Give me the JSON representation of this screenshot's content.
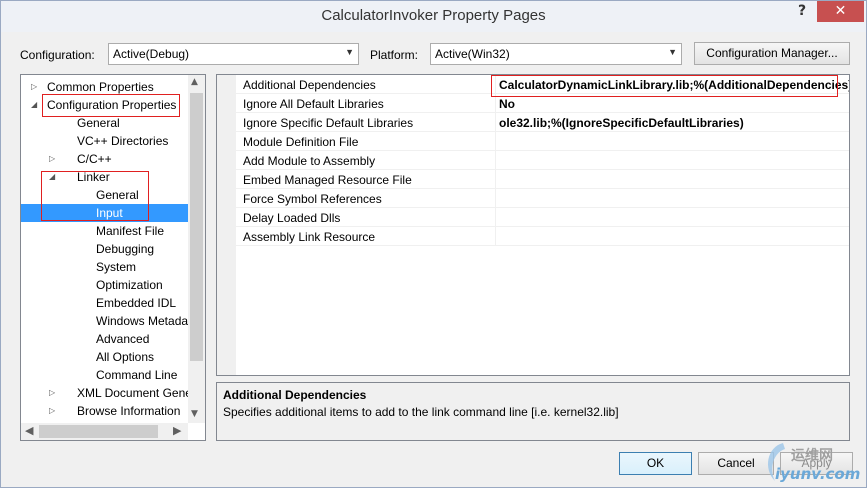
{
  "window": {
    "title": "CalculatorInvoker Property Pages",
    "help_label": "?",
    "close_label": "✕"
  },
  "config": {
    "configuration_label": "Configuration:",
    "configuration_value": "Active(Debug)",
    "platform_label": "Platform:",
    "platform_value": "Active(Win32)",
    "manager_button": "Configuration Manager..."
  },
  "tree": {
    "items": [
      {
        "label": "Common Properties",
        "expander": "▷"
      },
      {
        "label": "Configuration Properties",
        "expander": "◢"
      },
      {
        "label": "General",
        "expander": ""
      },
      {
        "label": "VC++ Directories",
        "expander": ""
      },
      {
        "label": "C/C++",
        "expander": "▷"
      },
      {
        "label": "Linker",
        "expander": "◢"
      },
      {
        "label": "General",
        "expander": ""
      },
      {
        "label": "Input",
        "expander": ""
      },
      {
        "label": "Manifest File",
        "expander": ""
      },
      {
        "label": "Debugging",
        "expander": ""
      },
      {
        "label": "System",
        "expander": ""
      },
      {
        "label": "Optimization",
        "expander": ""
      },
      {
        "label": "Embedded IDL",
        "expander": ""
      },
      {
        "label": "Windows Metadata",
        "expander": ""
      },
      {
        "label": "Advanced",
        "expander": ""
      },
      {
        "label": "All Options",
        "expander": ""
      },
      {
        "label": "Command Line",
        "expander": ""
      },
      {
        "label": "XML Document Genera",
        "expander": "▷"
      },
      {
        "label": "Browse Information",
        "expander": "▷"
      }
    ],
    "selected": "Input"
  },
  "properties": {
    "rows": [
      {
        "name": "Additional Dependencies",
        "value": "CalculatorDynamicLinkLibrary.lib;%(AdditionalDependencies)"
      },
      {
        "name": "Ignore All Default Libraries",
        "value": "No"
      },
      {
        "name": "Ignore Specific Default Libraries",
        "value": "ole32.lib;%(IgnoreSpecificDefaultLibraries)"
      },
      {
        "name": "Module Definition File",
        "value": ""
      },
      {
        "name": "Add Module to Assembly",
        "value": ""
      },
      {
        "name": "Embed Managed Resource File",
        "value": ""
      },
      {
        "name": "Force Symbol References",
        "value": ""
      },
      {
        "name": "Delay Loaded Dlls",
        "value": ""
      },
      {
        "name": "Assembly Link Resource",
        "value": ""
      }
    ]
  },
  "description": {
    "title": "Additional Dependencies",
    "text": "Specifies additional items to add to the link command line [i.e. kernel32.lib]"
  },
  "buttons": {
    "ok": "OK",
    "cancel": "Cancel",
    "apply": "Apply"
  },
  "watermark": {
    "cn": "运维网",
    "en": "iyunv.com"
  },
  "colors": {
    "selection": "#3399ff",
    "highlight_box": "#e02020",
    "close_button": "#c75050"
  }
}
